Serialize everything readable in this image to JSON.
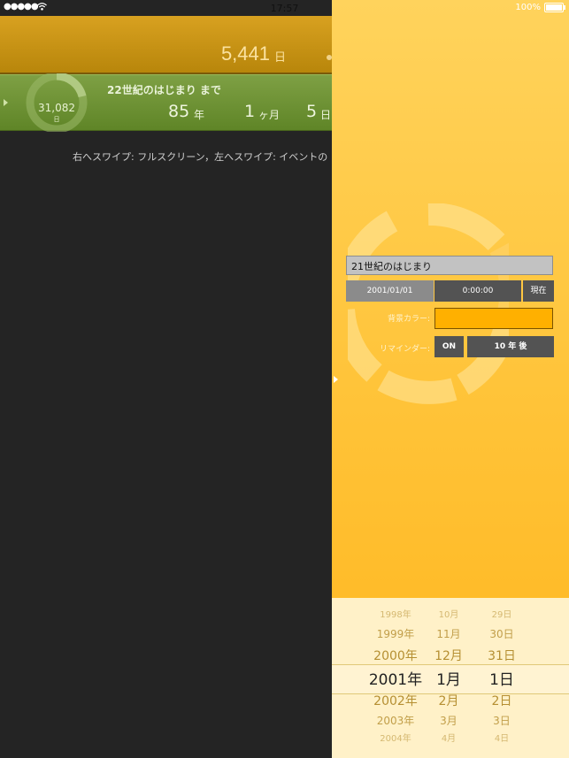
{
  "statusbar": {
    "signal": "●●●●●",
    "time": "17:57",
    "battery": "100%"
  },
  "left": {
    "row1": {
      "value": "5,441",
      "unit": "日"
    },
    "row2": {
      "days": "31,082",
      "days_unit": "日",
      "title": "22世紀のはじまり まで",
      "years": "85",
      "years_unit": "年",
      "months": "1",
      "months_unit": "ヶ月",
      "days2": "5",
      "days2_unit": "日"
    },
    "hint": "右へスワイプ: フルスクリーン，左へスワイプ: イベントの"
  },
  "detail": {
    "title_value": "21世紀のはじまり",
    "date": "2001/01/01",
    "time": "0:00:00",
    "now_label": "現在",
    "bg_color_label": "背景カラー:",
    "bg_color": "#ffb000",
    "reminder_label": "リマインダー:",
    "reminder_toggle": "ON",
    "reminder_offset": "10 年 後"
  },
  "picker": {
    "years": [
      "1998年",
      "1999年",
      "2000年",
      "2001年",
      "2002年",
      "2003年",
      "2004年"
    ],
    "months": [
      "10月",
      "11月",
      "12月",
      "1月",
      "2月",
      "3月",
      "4月"
    ],
    "days": [
      "29日",
      "30日",
      "31日",
      "1日",
      "2日",
      "3日",
      "4日"
    ]
  },
  "colors": {
    "row1": "#c8941a",
    "row2": "#6f9434",
    "panel": "#ffc43a"
  }
}
